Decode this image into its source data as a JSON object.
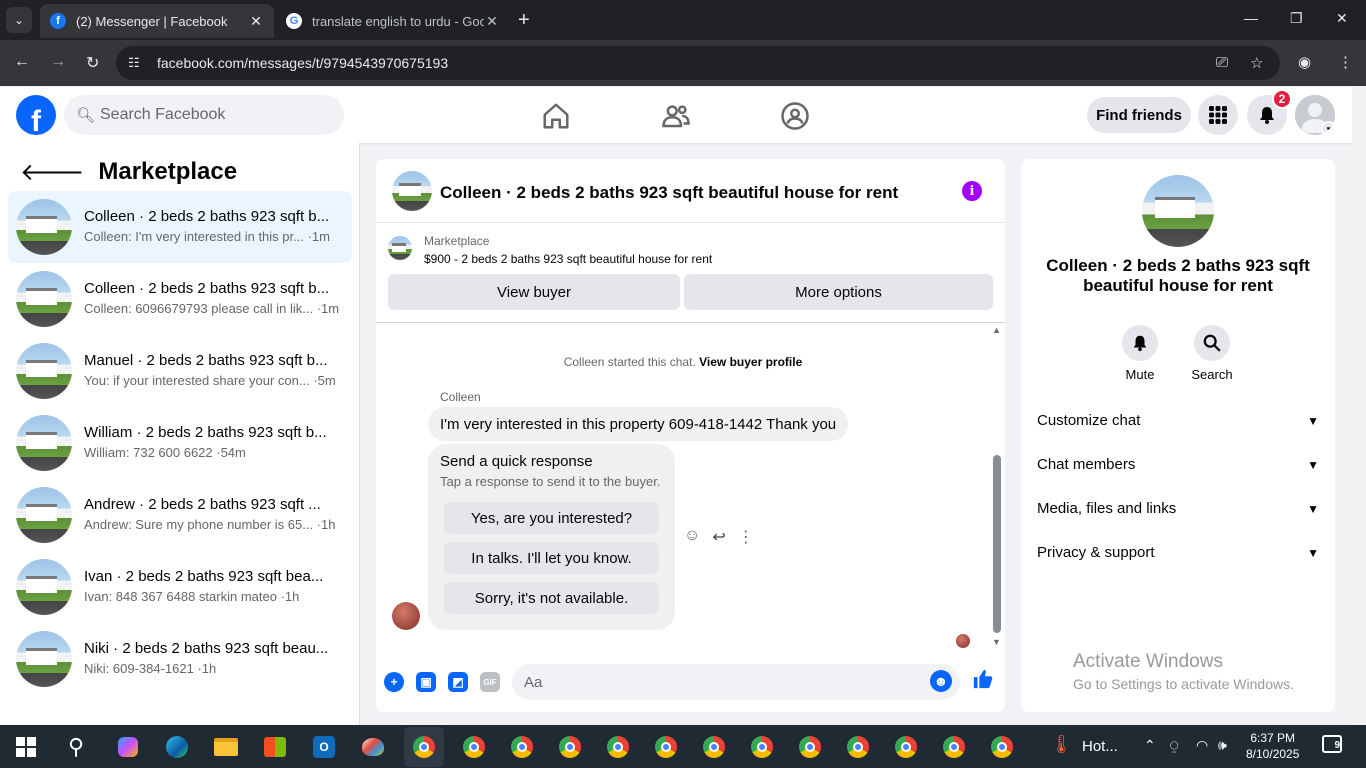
{
  "browser": {
    "tabs": [
      {
        "title": "(2) Messenger | Facebook",
        "favicon": "facebook-icon"
      },
      {
        "title": "translate english to urdu - Goo",
        "favicon": "google-icon"
      }
    ],
    "url": "facebook.com/messages/t/9794543970675193"
  },
  "fb": {
    "search_placeholder": "Search Facebook",
    "find_friends": "Find friends",
    "notif_count": "2",
    "brand_color": "#0866ff"
  },
  "sidebar": {
    "title": "Marketplace",
    "items": [
      {
        "name": "Colleen · 2 beds 2 baths 923 sqft b...",
        "preview": "Colleen: I'm very interested in this pr... ·1m"
      },
      {
        "name": "Colleen · 2 beds 2 baths 923 sqft b...",
        "preview": "Colleen: 6096679793 please call in lik... ·1m"
      },
      {
        "name": "Manuel · 2 beds 2 baths 923 sqft b...",
        "preview": "You: if your interested share your con... ·5m"
      },
      {
        "name": "William · 2 beds 2 baths 923 sqft b...",
        "preview": "William: 732 600 6622 ·54m"
      },
      {
        "name": "Andrew · 2 beds 2 baths 923 sqft ...",
        "preview": "Andrew: Sure my phone number is 65... ·1h"
      },
      {
        "name": "Ivan · 2 beds 2 baths 923 sqft bea...",
        "preview": "Ivan: 848 367 6488 starkin mateo ·1h"
      },
      {
        "name": "Niki · 2 beds 2 baths 923 sqft beau...",
        "preview": "Niki: 609-384-1621 ·1h"
      }
    ]
  },
  "chat": {
    "title": "Colleen · 2 beds 2 baths 923 sqft beautiful house for rent",
    "marketplace_label": "Marketplace",
    "listing": "$900 - 2 beds 2 baths 923 sqft beautiful house for rent",
    "view_buyer": "View buyer",
    "more_options": "More options",
    "system_msg": "Colleen started this chat.",
    "view_buyer_profile": "View buyer profile",
    "sender": "Colleen",
    "message": "I'm very interested in this property 609-418-1442 Thank you",
    "quick_title": "Send a quick response",
    "quick_sub": "Tap a response to send it to the buyer.",
    "quick_responses": [
      "Yes, are you interested?",
      "In talks. I'll let you know.",
      "Sorry, it's not available."
    ],
    "composer_placeholder": "Aa",
    "composer_gif": "GIF"
  },
  "right": {
    "name": "Colleen · 2 beds 2 baths 923 sqft beautiful house for rent",
    "mute": "Mute",
    "search": "Search",
    "sections": [
      "Customize chat",
      "Chat members",
      "Media, files and links",
      "Privacy & support"
    ],
    "watermark_title": "Activate Windows",
    "watermark_sub": "Go to Settings to activate Windows."
  },
  "taskbar": {
    "weather": "Hot...",
    "time": "6:37 PM",
    "date": "8/10/2025",
    "notif": "9"
  }
}
